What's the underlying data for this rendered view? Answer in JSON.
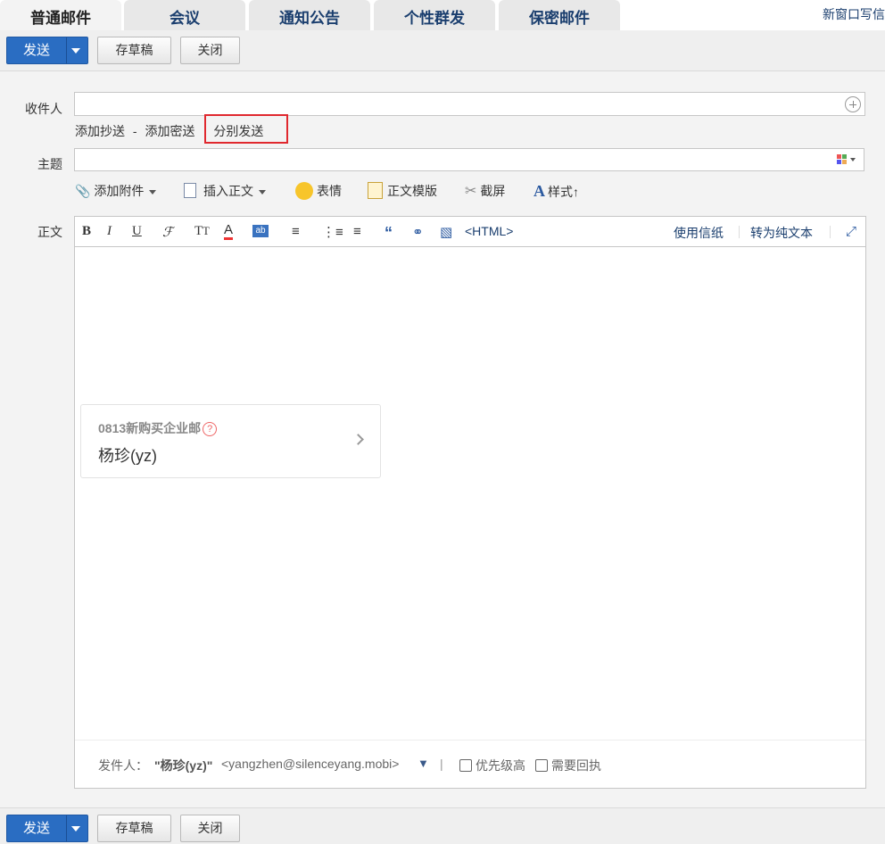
{
  "tabs": [
    {
      "label": "普通邮件",
      "active": true
    },
    {
      "label": "会议",
      "active": false
    },
    {
      "label": "通知公告",
      "active": false
    },
    {
      "label": "个性群发",
      "active": false
    },
    {
      "label": "保密邮件",
      "active": false
    }
  ],
  "new_window_label": "新窗口写信",
  "toolbar": {
    "send_label": "发送",
    "draft_label": "存草稿",
    "close_label": "关闭"
  },
  "form": {
    "recipient_label": "收件人",
    "recipient_value": "",
    "add_cc_label": "添加抄送",
    "link_separator": "-",
    "add_bcc_label": "添加密送",
    "separate_send_label": "分别发送",
    "subject_label": "主题",
    "subject_value": "",
    "body_label": "正文"
  },
  "attach_toolbar": {
    "attach_label": "添加附件",
    "insert_body_label": "插入正文",
    "emoji_label": "表情",
    "template_label": "正文模版",
    "screenshot_label": "截屏",
    "style_label": "样式↑"
  },
  "editor_toolbar": {
    "html_label": "<HTML>",
    "stationery_label": "使用信纸",
    "plain_text_label": "转为纯文本"
  },
  "signature_card": {
    "title": "0813新购买企业邮",
    "help_glyph": "?",
    "name": "杨珍(yz)"
  },
  "footer": {
    "sender_label": "发件人：",
    "sender_name": "\"杨珍(yz)\"",
    "sender_email": "<yangzhen@silenceyang.mobi>",
    "dropdown_glyph": "▼",
    "divider": "|",
    "priority_label": "优先级高",
    "receipt_label": "需要回执"
  },
  "colors": {
    "primary": "#2a6dc2",
    "tab_text": "#1a3e6e",
    "highlight_border": "#e0282e"
  }
}
